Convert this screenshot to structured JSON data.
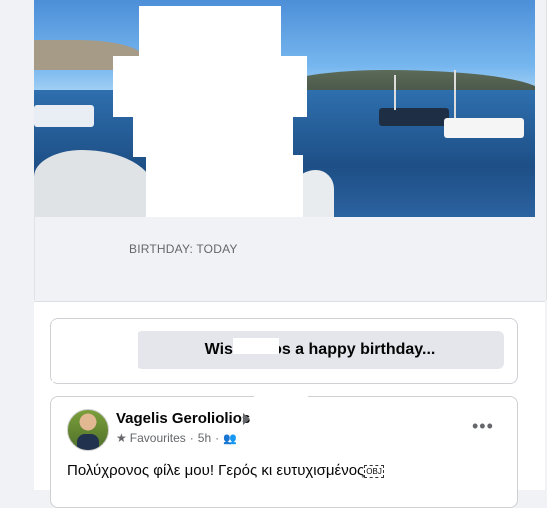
{
  "birthday_label": "BIRTHDAY: TODAY",
  "wish_button_label": "Wish Nikos a happy birthday...",
  "post": {
    "author": "Vagelis Geroliolios",
    "audience": "Favourites",
    "time": "5h",
    "text": "Πολύχρονος φίλε μου! Γερός κι ευτυχισμένος",
    "obj_glyph": "OBJ"
  },
  "icons": {
    "audience_icon": "star-icon",
    "privacy_icon": "friends-icon",
    "more_icon": "more-options-icon",
    "arrow_icon": "triangle-right-icon"
  },
  "colors": {
    "background": "#f0f2f5",
    "button_bg": "#e4e6eb",
    "secondary_text": "#65676b",
    "primary_text": "#050505"
  }
}
